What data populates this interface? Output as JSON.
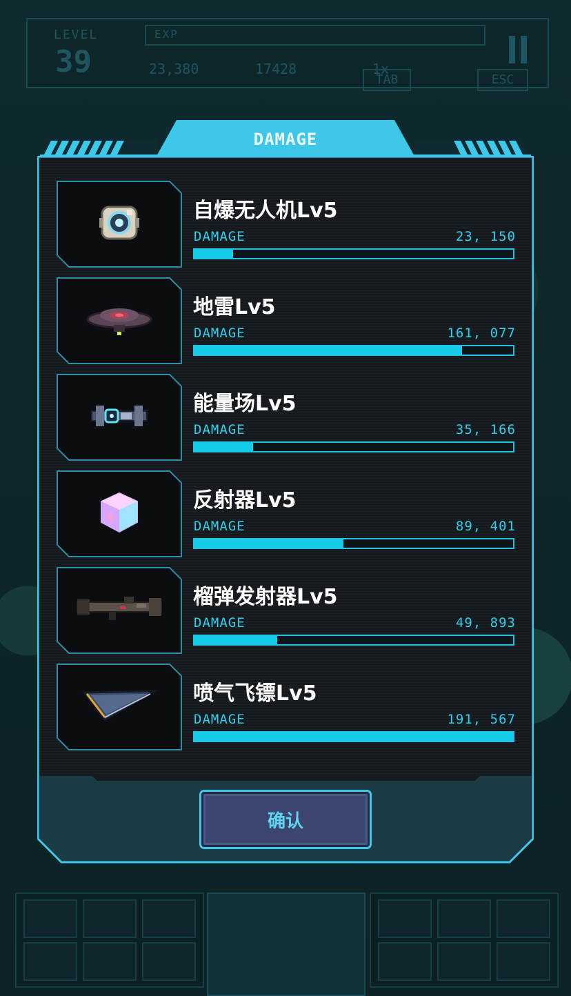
{
  "hud": {
    "level_label": "LEVEL",
    "level_value": "39",
    "exp_label": "EXP",
    "coins": "23,380",
    "kills": "17428",
    "speed": "1x",
    "tab_key": "TAB",
    "esc_key": "ESC"
  },
  "modal": {
    "title": "DAMAGE",
    "confirm_label": "确认",
    "damage_max": 191567,
    "items": [
      {
        "name": "自爆无人机Lv5",
        "damage_label": "DAMAGE",
        "damage_text": "23, 150",
        "damage": 23150,
        "icon": "drone-icon"
      },
      {
        "name": "地雷Lv5",
        "damage_label": "DAMAGE",
        "damage_text": "161, 077",
        "damage": 161077,
        "icon": "landmine-icon"
      },
      {
        "name": "能量场Lv5",
        "damage_label": "DAMAGE",
        "damage_text": "35, 166",
        "damage": 35166,
        "icon": "energy-field-icon"
      },
      {
        "name": "反射器Lv5",
        "damage_label": "DAMAGE",
        "damage_text": "89, 401",
        "damage": 89401,
        "icon": "reflector-cube-icon"
      },
      {
        "name": "榴弹发射器Lv5",
        "damage_label": "DAMAGE",
        "damage_text": "49, 893",
        "damage": 49893,
        "icon": "grenade-launcher-icon"
      },
      {
        "name": "喷气飞镖Lv5",
        "damage_label": "DAMAGE",
        "damage_text": "191, 567",
        "damage": 191567,
        "icon": "jet-dart-icon"
      }
    ]
  },
  "colors": {
    "accent": "#14cbe9",
    "panel_border": "#3ec7e8",
    "button": "#3c4570"
  }
}
